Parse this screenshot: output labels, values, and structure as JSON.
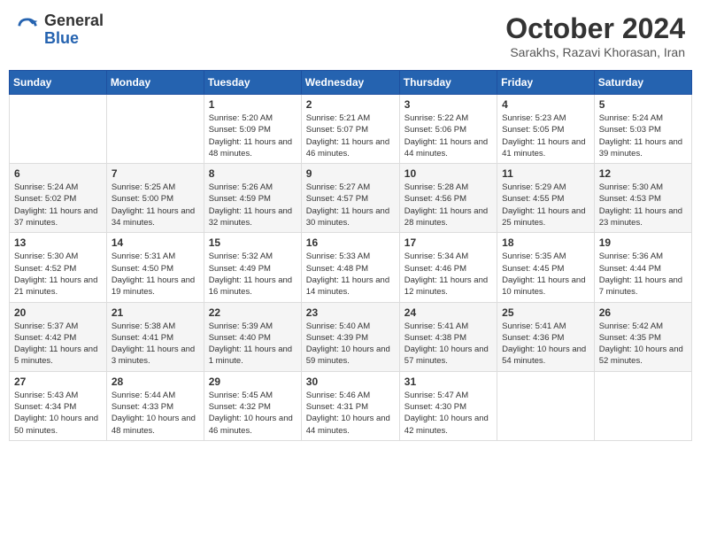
{
  "header": {
    "logo_general": "General",
    "logo_blue": "Blue",
    "month_title": "October 2024",
    "subtitle": "Sarakhs, Razavi Khorasan, Iran"
  },
  "weekdays": [
    "Sunday",
    "Monday",
    "Tuesday",
    "Wednesday",
    "Thursday",
    "Friday",
    "Saturday"
  ],
  "weeks": [
    [
      null,
      null,
      {
        "day": 1,
        "sunrise": "5:20 AM",
        "sunset": "5:09 PM",
        "daylight": "11 hours and 48 minutes."
      },
      {
        "day": 2,
        "sunrise": "5:21 AM",
        "sunset": "5:07 PM",
        "daylight": "11 hours and 46 minutes."
      },
      {
        "day": 3,
        "sunrise": "5:22 AM",
        "sunset": "5:06 PM",
        "daylight": "11 hours and 44 minutes."
      },
      {
        "day": 4,
        "sunrise": "5:23 AM",
        "sunset": "5:05 PM",
        "daylight": "11 hours and 41 minutes."
      },
      {
        "day": 5,
        "sunrise": "5:24 AM",
        "sunset": "5:03 PM",
        "daylight": "11 hours and 39 minutes."
      }
    ],
    [
      {
        "day": 6,
        "sunrise": "5:24 AM",
        "sunset": "5:02 PM",
        "daylight": "11 hours and 37 minutes."
      },
      {
        "day": 7,
        "sunrise": "5:25 AM",
        "sunset": "5:00 PM",
        "daylight": "11 hours and 34 minutes."
      },
      {
        "day": 8,
        "sunrise": "5:26 AM",
        "sunset": "4:59 PM",
        "daylight": "11 hours and 32 minutes."
      },
      {
        "day": 9,
        "sunrise": "5:27 AM",
        "sunset": "4:57 PM",
        "daylight": "11 hours and 30 minutes."
      },
      {
        "day": 10,
        "sunrise": "5:28 AM",
        "sunset": "4:56 PM",
        "daylight": "11 hours and 28 minutes."
      },
      {
        "day": 11,
        "sunrise": "5:29 AM",
        "sunset": "4:55 PM",
        "daylight": "11 hours and 25 minutes."
      },
      {
        "day": 12,
        "sunrise": "5:30 AM",
        "sunset": "4:53 PM",
        "daylight": "11 hours and 23 minutes."
      }
    ],
    [
      {
        "day": 13,
        "sunrise": "5:30 AM",
        "sunset": "4:52 PM",
        "daylight": "11 hours and 21 minutes."
      },
      {
        "day": 14,
        "sunrise": "5:31 AM",
        "sunset": "4:50 PM",
        "daylight": "11 hours and 19 minutes."
      },
      {
        "day": 15,
        "sunrise": "5:32 AM",
        "sunset": "4:49 PM",
        "daylight": "11 hours and 16 minutes."
      },
      {
        "day": 16,
        "sunrise": "5:33 AM",
        "sunset": "4:48 PM",
        "daylight": "11 hours and 14 minutes."
      },
      {
        "day": 17,
        "sunrise": "5:34 AM",
        "sunset": "4:46 PM",
        "daylight": "11 hours and 12 minutes."
      },
      {
        "day": 18,
        "sunrise": "5:35 AM",
        "sunset": "4:45 PM",
        "daylight": "11 hours and 10 minutes."
      },
      {
        "day": 19,
        "sunrise": "5:36 AM",
        "sunset": "4:44 PM",
        "daylight": "11 hours and 7 minutes."
      }
    ],
    [
      {
        "day": 20,
        "sunrise": "5:37 AM",
        "sunset": "4:42 PM",
        "daylight": "11 hours and 5 minutes."
      },
      {
        "day": 21,
        "sunrise": "5:38 AM",
        "sunset": "4:41 PM",
        "daylight": "11 hours and 3 minutes."
      },
      {
        "day": 22,
        "sunrise": "5:39 AM",
        "sunset": "4:40 PM",
        "daylight": "11 hours and 1 minute."
      },
      {
        "day": 23,
        "sunrise": "5:40 AM",
        "sunset": "4:39 PM",
        "daylight": "10 hours and 59 minutes."
      },
      {
        "day": 24,
        "sunrise": "5:41 AM",
        "sunset": "4:38 PM",
        "daylight": "10 hours and 57 minutes."
      },
      {
        "day": 25,
        "sunrise": "5:41 AM",
        "sunset": "4:36 PM",
        "daylight": "10 hours and 54 minutes."
      },
      {
        "day": 26,
        "sunrise": "5:42 AM",
        "sunset": "4:35 PM",
        "daylight": "10 hours and 52 minutes."
      }
    ],
    [
      {
        "day": 27,
        "sunrise": "5:43 AM",
        "sunset": "4:34 PM",
        "daylight": "10 hours and 50 minutes."
      },
      {
        "day": 28,
        "sunrise": "5:44 AM",
        "sunset": "4:33 PM",
        "daylight": "10 hours and 48 minutes."
      },
      {
        "day": 29,
        "sunrise": "5:45 AM",
        "sunset": "4:32 PM",
        "daylight": "10 hours and 46 minutes."
      },
      {
        "day": 30,
        "sunrise": "5:46 AM",
        "sunset": "4:31 PM",
        "daylight": "10 hours and 44 minutes."
      },
      {
        "day": 31,
        "sunrise": "5:47 AM",
        "sunset": "4:30 PM",
        "daylight": "10 hours and 42 minutes."
      },
      null,
      null
    ]
  ]
}
